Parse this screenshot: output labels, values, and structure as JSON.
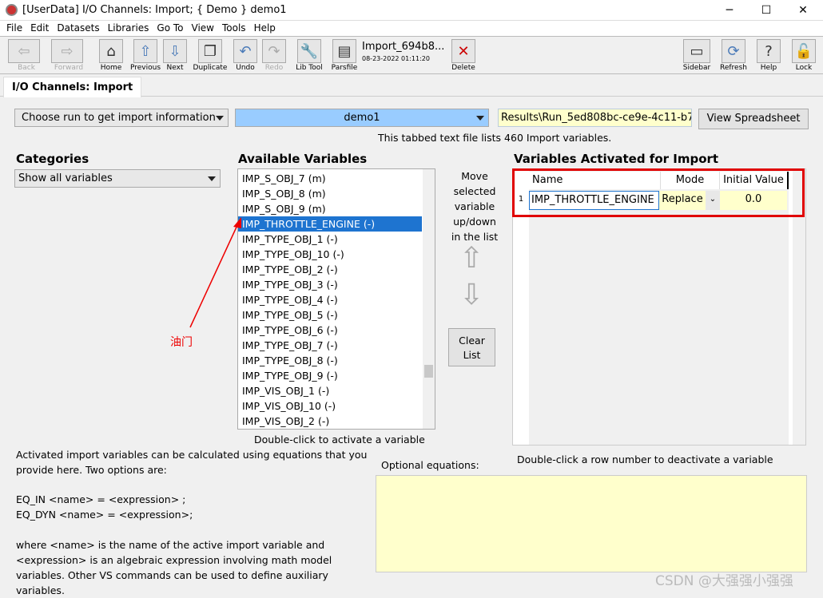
{
  "window": {
    "title": "[UserData] I/O Channels: Import; { Demo } demo1",
    "minimize": "─",
    "maximize": "☐",
    "close": "✕"
  },
  "menu": [
    "File",
    "Edit",
    "Datasets",
    "Libraries",
    "Go To",
    "View",
    "Tools",
    "Help"
  ],
  "toolbar": {
    "back": "Back",
    "forward": "Forward",
    "home": "Home",
    "previous": "Previous",
    "next": "Next",
    "duplicate": "Duplicate",
    "undo": "Undo",
    "redo": "Redo",
    "libtool": "Lib Tool",
    "parsfile": "Parsfile",
    "dataset_name": "Import_694b8...",
    "dataset_date": "08-23-2022 01:11:20",
    "delete": "Delete",
    "sidebar": "Sidebar",
    "refresh": "Refresh",
    "help": "Help",
    "lock": "Lock"
  },
  "tab": "I/O Channels: Import",
  "run": {
    "choose": "Choose run to get import information",
    "selected": "demo1",
    "path": "Results\\Run_5ed808bc-ce9e-4c11-b7a",
    "view_spreadsheet": "View Spreadsheet",
    "info": "This tabbed text file lists 460 Import variables."
  },
  "categories": {
    "title": "Categories",
    "selected": "Show all variables"
  },
  "available": {
    "title": "Available Variables",
    "items": [
      "IMP_S_OBJ_7 (m)",
      "IMP_S_OBJ_8 (m)",
      "IMP_S_OBJ_9 (m)",
      "IMP_THROTTLE_ENGINE (-)",
      "IMP_TYPE_OBJ_1 (-)",
      "IMP_TYPE_OBJ_10 (-)",
      "IMP_TYPE_OBJ_2 (-)",
      "IMP_TYPE_OBJ_3 (-)",
      "IMP_TYPE_OBJ_4 (-)",
      "IMP_TYPE_OBJ_5 (-)",
      "IMP_TYPE_OBJ_6 (-)",
      "IMP_TYPE_OBJ_7 (-)",
      "IMP_TYPE_OBJ_8 (-)",
      "IMP_TYPE_OBJ_9 (-)",
      "IMP_VIS_OBJ_1 (-)",
      "IMP_VIS_OBJ_10 (-)",
      "IMP_VIS_OBJ_2 (-)"
    ],
    "selected_index": 3,
    "hint": "Double-click to activate a variable"
  },
  "annotation": "油门",
  "move": {
    "text": "Move selected variable up/down in the list",
    "clear": "Clear List"
  },
  "activated": {
    "title": "Variables Activated for Import",
    "headers": [
      "Name",
      "Mode",
      "Initial Value"
    ],
    "rows": [
      {
        "num": "1",
        "name": "IMP_THROTTLE_ENGINE",
        "mode": "Replace",
        "initial": "0.0"
      }
    ],
    "hint": "Double-click a row number to deactivate a variable"
  },
  "equations": {
    "intro": "Activated import variables can be calculated using equations that you provide here. Two options are:",
    "eq_in": "EQ_IN <name> = <expression> ;",
    "eq_dyn": "EQ_DYN <name> = <expression>;",
    "desc": "where <name> is the name of the active import variable and <expression> is an algebraic expression involving math model variables. Other VS commands can be used to define auxiliary variables.",
    "label": "Optional equations:",
    "value": ""
  },
  "watermark": "CSDN @大强强小强强",
  "colors": {
    "selection": "#1e74d0",
    "highlight_border": "#e00000",
    "input_bg": "#ffffcc",
    "run_bg": "#99ccff"
  }
}
